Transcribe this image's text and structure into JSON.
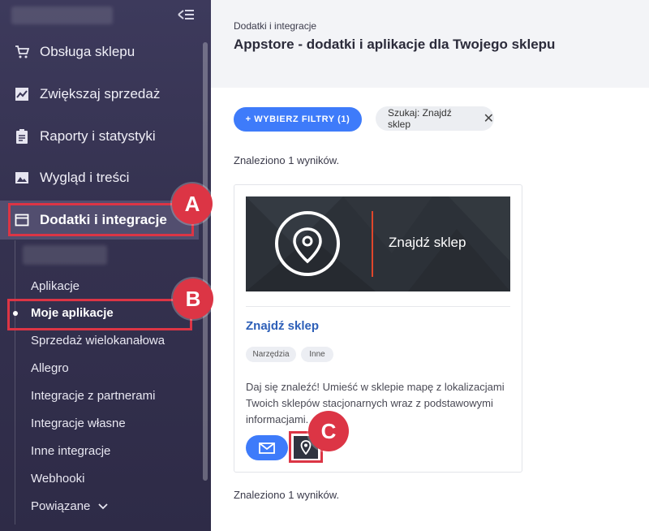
{
  "sidebar": {
    "items": [
      {
        "label": "Obsługa sklepu",
        "icon": "cart-icon"
      },
      {
        "label": "Zwiększaj sprzedaż",
        "icon": "chart-icon"
      },
      {
        "label": "Raporty i statystyki",
        "icon": "clipboard-icon"
      },
      {
        "label": "Wygląd i treści",
        "icon": "image-icon"
      },
      {
        "label": "Dodatki i integracje",
        "icon": "window-icon"
      }
    ],
    "subitems": [
      {
        "label": "Aplikacje"
      },
      {
        "label": "Moje aplikacje"
      },
      {
        "label": "Sprzedaż wielokanałowa"
      },
      {
        "label": "Allegro"
      },
      {
        "label": "Integracje z partnerami"
      },
      {
        "label": "Integracje własne"
      },
      {
        "label": "Inne integracje"
      },
      {
        "label": "Webhooki"
      },
      {
        "label": "Powiązane"
      }
    ]
  },
  "markers": {
    "a": "A",
    "b": "B",
    "c": "C"
  },
  "header": {
    "breadcrumb": "Dodatki i integracje",
    "title": "Appstore - dodatki i aplikacje dla Twojego sklepu"
  },
  "filters": {
    "button_label": "+ WYBIERZ FILTRY (1)",
    "search_chip": "Szukaj: Znajdź sklep"
  },
  "results_text": "Znaleziono 1 wyników.",
  "card": {
    "banner_text": "Znajdź sklep",
    "title": "Znajdź sklep",
    "tags": [
      "Narzędzia",
      "Inne"
    ],
    "description": "Daj się znaleźć! Umieść w sklepie mapę z lokalizacjami Twoich sklepów stacjonarnych wraz z podstawowymi informacjami."
  },
  "colors": {
    "accent": "#3e7bfa",
    "marker": "#dc3545",
    "sidebar": "#3a3757"
  }
}
